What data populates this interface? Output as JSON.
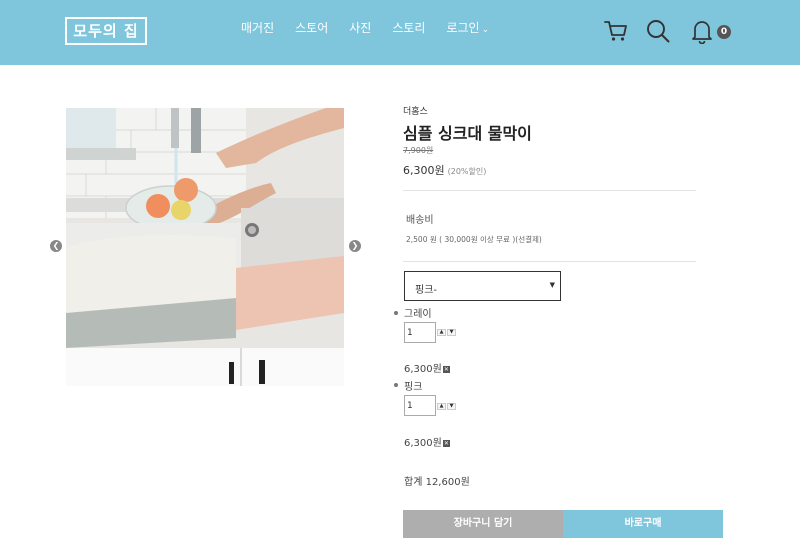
{
  "header": {
    "logo": "모두의 집",
    "nav": [
      {
        "label": "매거진"
      },
      {
        "label": "스토어"
      },
      {
        "label": "사진"
      },
      {
        "label": "스토리"
      },
      {
        "label": "로그인",
        "has_dropdown": true
      }
    ],
    "icons": [
      "cart-icon",
      "search-icon",
      "bell-icon"
    ],
    "notification_count": "0",
    "color": "#7fc5dc"
  },
  "gallery": {
    "image_alt": "sink-rack-product-photo",
    "prev_icon": "chevron-left-icon",
    "next_icon": "chevron-right-icon"
  },
  "product": {
    "brand": "더홈스",
    "title": "심플 싱크대 물막이",
    "original_price": "7,900원",
    "price": "6,300원",
    "discount": "(20%할인)",
    "shipping_label": "배송비",
    "shipping_info": "2,500 원 ( 30,000원 이상 무료 )(선결제)",
    "option_select_value": "핑크-",
    "selected_options": [
      {
        "name": "그레이",
        "quantity": "1",
        "price": "6,300원"
      },
      {
        "name": "핑크",
        "quantity": "1",
        "price": "6,300원"
      }
    ],
    "total": "합계 12,600원"
  },
  "buttons": {
    "cart": "장바구니 담기",
    "buy": "바로구매"
  },
  "colors": {
    "accent": "#7fc5dc",
    "cart_button": "#aeaeae"
  }
}
